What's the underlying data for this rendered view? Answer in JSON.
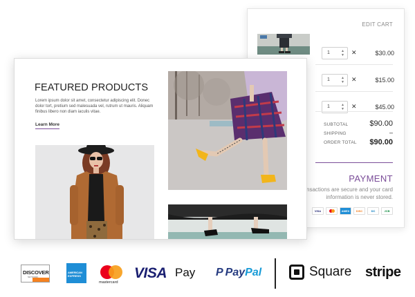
{
  "cart": {
    "edit_label": "EDIT CART",
    "items": [
      {
        "qty": "1",
        "price": "$30.00"
      },
      {
        "qty": "1",
        "price": "$15.00"
      },
      {
        "qty": "1",
        "price": "$45.00"
      }
    ],
    "remove_symbol": "✕",
    "subtotal_label": "SUBTOTAL",
    "subtotal_value": "$90.00",
    "shipping_label": "SHIPPING",
    "shipping_value": "–",
    "order_total_label": "ORDER TOTAL",
    "order_total_value": "$90.00"
  },
  "payment": {
    "title": "PAYMENT",
    "text": "ransactions are secure and your card information is never stored.",
    "card_icons": [
      "visa-icon",
      "mastercard-icon",
      "amex-icon",
      "discover-icon",
      "diners-icon",
      "jcb-icon"
    ],
    "mini_labels": {
      "visa": "VISA",
      "amex": "AMEX",
      "discover": "DISC",
      "diners": "DC",
      "jcb": "JCB"
    }
  },
  "featured": {
    "title": "FEATURED PRODUCTS",
    "description": "Lorem ipsum dolor sit amet, consectetur adipiscing elit. Donec dolor tort, pretium sed malesuada vel, rutrum ut mauris. Aliquam finibus libero non diam iaculis vitae.",
    "learn_more": "Learn More"
  },
  "logos": {
    "discover": "DISCOVER",
    "discover_sub": "NETWORK",
    "amex_top": "AMERICAN",
    "amex_bottom": "EXPRESS",
    "mastercard": "mastercard",
    "visa": "VISA",
    "applepay_symbol": "",
    "applepay": "Pay",
    "paypal_icon": "P",
    "paypal_a": "Pay",
    "paypal_b": "Pal",
    "square": "Square",
    "stripe": "stripe"
  },
  "colors": {
    "accent_purple": "#7a4c98",
    "visa_blue": "#1a1f71",
    "mastercard_red": "#eb001b",
    "mastercard_orange": "#f79e1b",
    "amex_blue": "#1f8ed6",
    "paypal_dark": "#253b80",
    "paypal_light": "#179bd7",
    "discover_orange": "#f58220"
  }
}
